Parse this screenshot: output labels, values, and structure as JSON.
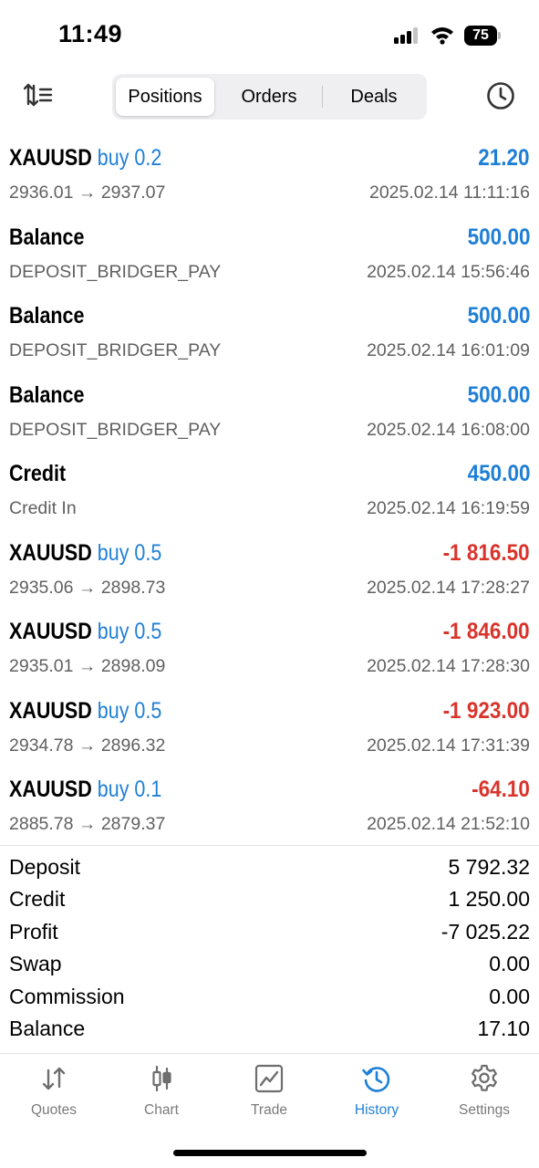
{
  "status_bar": {
    "time": "11:49",
    "battery": "75"
  },
  "header": {
    "tabs": [
      {
        "label": "Positions",
        "active": true
      },
      {
        "label": "Orders",
        "active": false
      },
      {
        "label": "Deals",
        "active": false
      }
    ],
    "left_icon": "sort-icon",
    "right_icon": "history-clock-icon"
  },
  "deals": [
    {
      "symbol": "XAUUSD",
      "direction": "buy 0.2",
      "amount": "21.20",
      "sign": "pos",
      "detail": "2936.01 → 2937.07",
      "time": "2025.02.14 11:11:16"
    },
    {
      "symbol": "Balance",
      "direction": "",
      "amount": "500.00",
      "sign": "pos",
      "detail": "DEPOSIT_BRIDGER_PAY",
      "time": "2025.02.14 15:56:46"
    },
    {
      "symbol": "Balance",
      "direction": "",
      "amount": "500.00",
      "sign": "pos",
      "detail": "DEPOSIT_BRIDGER_PAY",
      "time": "2025.02.14 16:01:09"
    },
    {
      "symbol": "Balance",
      "direction": "",
      "amount": "500.00",
      "sign": "pos",
      "detail": "DEPOSIT_BRIDGER_PAY",
      "time": "2025.02.14 16:08:00"
    },
    {
      "symbol": "Credit",
      "direction": "",
      "amount": "450.00",
      "sign": "pos",
      "detail": "Credit In",
      "time": "2025.02.14 16:19:59"
    },
    {
      "symbol": "XAUUSD",
      "direction": "buy 0.5",
      "amount": "-1 816.50",
      "sign": "neg",
      "detail": "2935.06 → 2898.73",
      "time": "2025.02.14 17:28:27"
    },
    {
      "symbol": "XAUUSD",
      "direction": "buy 0.5",
      "amount": "-1 846.00",
      "sign": "neg",
      "detail": "2935.01 → 2898.09",
      "time": "2025.02.14 17:28:30"
    },
    {
      "symbol": "XAUUSD",
      "direction": "buy 0.5",
      "amount": "-1 923.00",
      "sign": "neg",
      "detail": "2934.78 → 2896.32",
      "time": "2025.02.14 17:31:39"
    },
    {
      "symbol": "XAUUSD",
      "direction": "buy 0.1",
      "amount": "-64.10",
      "sign": "neg",
      "detail": "2885.78 → 2879.37",
      "time": "2025.02.14 21:52:10"
    }
  ],
  "summary": [
    {
      "label": "Deposit",
      "value": "5 792.32"
    },
    {
      "label": "Credit",
      "value": "1 250.00"
    },
    {
      "label": "Profit",
      "value": "-7 025.22"
    },
    {
      "label": "Swap",
      "value": "0.00"
    },
    {
      "label": "Commission",
      "value": "0.00"
    },
    {
      "label": "Balance",
      "value": "17.10"
    }
  ],
  "tabbar": [
    {
      "label": "Quotes",
      "icon": "quotes-arrows-icon",
      "active": false
    },
    {
      "label": "Chart",
      "icon": "candlestick-chart-icon",
      "active": false
    },
    {
      "label": "Trade",
      "icon": "trade-chart-icon",
      "active": false
    },
    {
      "label": "History",
      "icon": "history-clock-icon",
      "active": true
    },
    {
      "label": "Settings",
      "icon": "settings-gear-icon",
      "active": false
    }
  ],
  "colors": {
    "accent": "#1f7fd6",
    "negative": "#d9342b",
    "secondary_text": "#606060"
  }
}
